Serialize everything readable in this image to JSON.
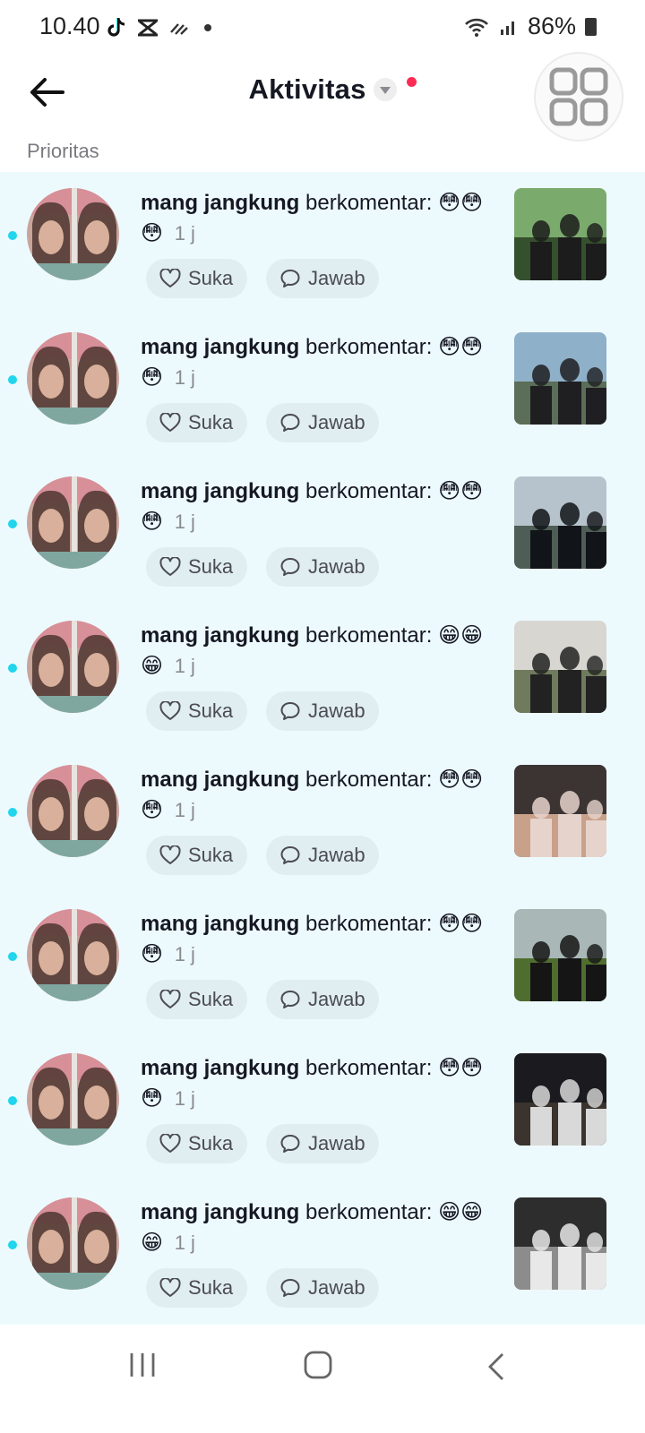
{
  "status_bar": {
    "time": "10.40",
    "battery": "86%"
  },
  "header": {
    "title": "Aktivitas"
  },
  "section": {
    "label": "Prioritas"
  },
  "items": [
    {
      "username": "mang jangkung",
      "verb": "berkomentar:",
      "emoji": [
        "😳",
        "😳",
        "😳"
      ],
      "time": "1 j",
      "like_label": "Suka",
      "reply_label": "Jawab"
    },
    {
      "username": "mang jangkung",
      "verb": "berkomentar:",
      "emoji": [
        "😳",
        "😳",
        "😳"
      ],
      "time": "1 j",
      "like_label": "Suka",
      "reply_label": "Jawab"
    },
    {
      "username": "mang jangkung",
      "verb": "berkomentar:",
      "emoji": [
        "😳",
        "😳",
        "😳"
      ],
      "time": "1 j",
      "like_label": "Suka",
      "reply_label": "Jawab"
    },
    {
      "username": "mang jangkung",
      "verb": "berkomentar:",
      "emoji": [
        "😁",
        "😁",
        "😁"
      ],
      "time": "1 j",
      "like_label": "Suka",
      "reply_label": "Jawab"
    },
    {
      "username": "mang jangkung",
      "verb": "berkomentar:",
      "emoji": [
        "😳",
        "😳",
        "😳"
      ],
      "time": "1 j",
      "like_label": "Suka",
      "reply_label": "Jawab"
    },
    {
      "username": "mang jangkung",
      "verb": "berkomentar:",
      "emoji": [
        "😳",
        "😳",
        "😳"
      ],
      "time": "1 j",
      "like_label": "Suka",
      "reply_label": "Jawab"
    },
    {
      "username": "mang jangkung",
      "verb": "berkomentar:",
      "emoji": [
        "😳",
        "😳",
        "😳"
      ],
      "time": "1 j",
      "like_label": "Suka",
      "reply_label": "Jawab"
    },
    {
      "username": "mang jangkung",
      "verb": "berkomentar:",
      "emoji": [
        "😁",
        "😁",
        "😁"
      ],
      "time": "1 j",
      "like_label": "Suka",
      "reply_label": "Jawab"
    }
  ],
  "colors": {
    "unread_dot": "#20d5ec",
    "list_bg": "#edfafd",
    "notification_dot": "#fe2c55"
  },
  "icons": [
    "back-arrow-icon",
    "dropdown-caret-icon",
    "grid-icon",
    "heart-icon",
    "comment-icon",
    "recent-apps-icon",
    "home-icon",
    "nav-back-icon"
  ]
}
